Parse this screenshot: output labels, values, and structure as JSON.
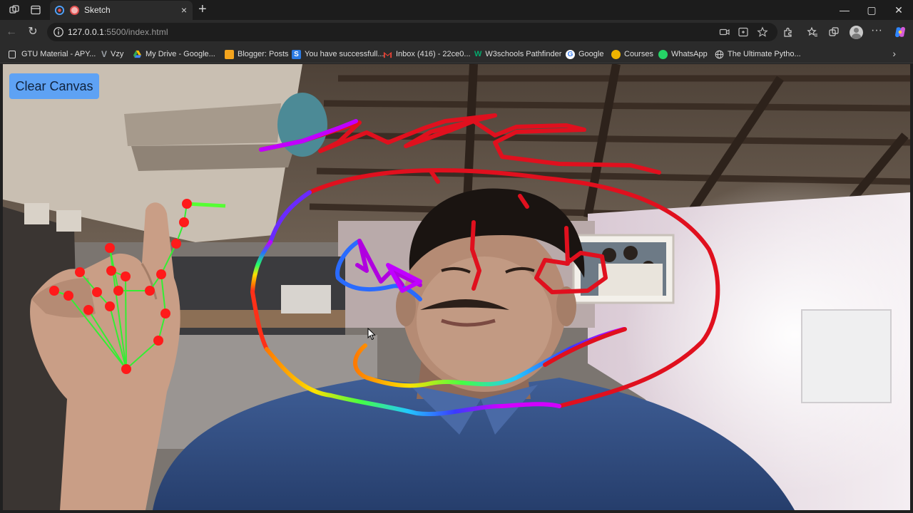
{
  "browser": {
    "tab_title": "Sketch",
    "tab_close": "×",
    "new_tab": "+",
    "window_controls": {
      "minimize": "—",
      "maximize": "▢",
      "close": "✕"
    },
    "address": {
      "host": "127.0.0.1",
      "rest": ":5500/index.html"
    },
    "bookmarks": [
      {
        "label": "GTU Material - APY...",
        "icon": "bookmark-page-icon",
        "color": "#dcdcdc"
      },
      {
        "label": "Vzy",
        "icon": "vzy-icon",
        "color": "#9aa0a6"
      },
      {
        "label": "My Drive - Google...",
        "icon": "google-drive-icon",
        "color": "#34a853"
      },
      {
        "label": "Blogger: Posts",
        "icon": "blogger-icon",
        "color": "#f4a41d"
      },
      {
        "label": "You have successfull...",
        "icon": "s-icon",
        "color": "#2b7be4"
      },
      {
        "label": "Inbox (416) - 22ce0...",
        "icon": "gmail-icon",
        "color": "#ea4335"
      },
      {
        "label": "W3schools Pathfinder",
        "icon": "w3schools-icon",
        "color": "#04aa6d"
      },
      {
        "label": "Google",
        "icon": "google-icon",
        "color": "#ffffff"
      },
      {
        "label": "Courses",
        "icon": "courses-icon",
        "color": "#f0b400"
      },
      {
        "label": "WhatsApp",
        "icon": "whatsapp-icon",
        "color": "#25d366"
      },
      {
        "label": "The Ultimate Pytho...",
        "icon": "globe-icon",
        "color": "#cfcfcf"
      }
    ]
  },
  "app": {
    "clear_button": "Clear Canvas"
  },
  "colors": {
    "stroke_red": "#e0101e",
    "button_blue": "#5ea2f4",
    "landmark_red": "#ff1a1a",
    "landmark_line": "#33ee33"
  }
}
